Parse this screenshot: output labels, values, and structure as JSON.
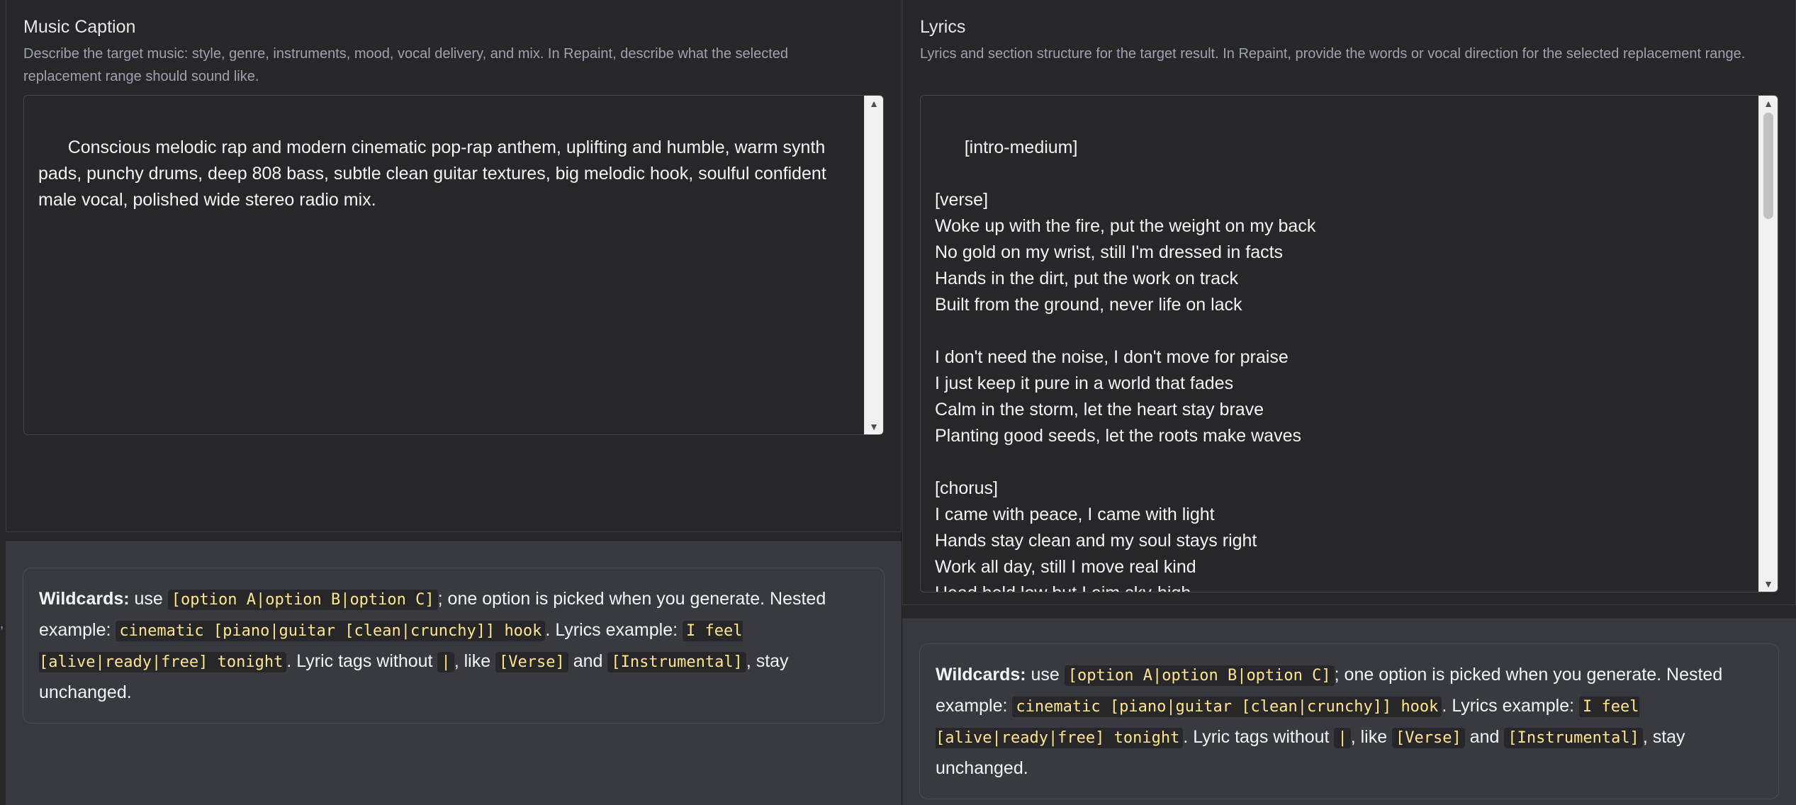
{
  "caption": {
    "label": "Music Caption",
    "info": "Describe the target music: style, genre, instruments, mood, vocal delivery, and mix. In Repaint, describe what the selected replacement range should sound like.",
    "value": "Conscious melodic rap and modern cinematic pop-rap anthem, uplifting and humble, warm synth pads, punchy drums, deep 808 bass, subtle clean guitar textures, big melodic hook, soulful confident male vocal, polished wide stereo radio mix."
  },
  "lyrics": {
    "label": "Lyrics",
    "info": "Lyrics and section structure for the target result. In Repaint, provide the words or vocal direction for the selected replacement range.",
    "value": "[intro-medium]\n\n[verse]\nWoke up with the fire, put the weight on my back\nNo gold on my wrist, still I'm dressed in facts\nHands in the dirt, put the work on track\nBuilt from the ground, never life on lack\n\nI don't need the noise, I don't move for praise\nI just keep it pure in a world that fades\nCalm in the storm, let the heart stay brave\nPlanting good seeds, let the roots make waves\n\n[chorus]\nI came with peace, I came with light\nHands stay clean and my soul stays right\nWork all day, still I move real kind\nHead held low but I aim sky-high"
  },
  "wildcards": {
    "title": "Wildcards:",
    "t1": " use ",
    "code1": "[option A|option B|option C]",
    "t2": "; one option is picked when you generate. Nested example: ",
    "code2": "cinematic [piano|guitar [clean|crunchy]] hook",
    "t3": ". Lyrics example: ",
    "code3": "I feel [alive|ready|free] tonight",
    "t4": ". Lyric tags without ",
    "code4": "|",
    "t5": ", like ",
    "code5": "[Verse]",
    "t6": " and ",
    "code6": "[Instrumental]",
    "t7": ", stay unchanged."
  },
  "scroll_icons": {
    "up": "▲",
    "down": "▼"
  },
  "edge_glyph": ","
}
